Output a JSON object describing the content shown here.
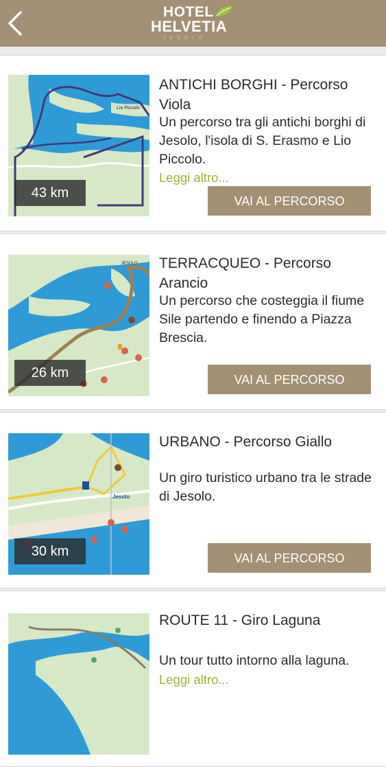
{
  "header": {
    "logo_line1": "HOTEL",
    "logo_line2": "HELVETIA",
    "logo_sub": "JESOLO"
  },
  "routes": [
    {
      "title": "ANTICHI BORGHI - Percorso Viola",
      "description": "Un percorso tra gli antichi borghi di Jesolo, l'isola di S. Erasmo e Lio Piccolo.",
      "more": "Leggi altro...",
      "distance": "43 km",
      "button": "VAI AL PERCORSO",
      "map_label": "Lio Piccolo"
    },
    {
      "title": "TERRACQUEO - Percorso Arancio",
      "description": "Un percorso che costeggia il fiume Sile partendo e finendo a Piazza Brescia.",
      "distance": "26 km",
      "button": "VAI AL PERCORSO",
      "map_label": "JESOLO"
    },
    {
      "title": "URBANO - Percorso Giallo",
      "description": "Un giro turistico urbano tra le strade di Jesolo.",
      "distance": "30 km",
      "button": "VAI AL PERCORSO",
      "map_label": "Jesolo"
    },
    {
      "title": "ROUTE 11 - Giro Laguna",
      "description": "Un tour tutto intorno alla laguna.",
      "more": "Leggi altro..."
    }
  ],
  "colors": {
    "header": "#a39074",
    "button": "#a39074",
    "link": "#9ab33a",
    "water": "#2f9bd6",
    "land": "#d7e8c6"
  }
}
